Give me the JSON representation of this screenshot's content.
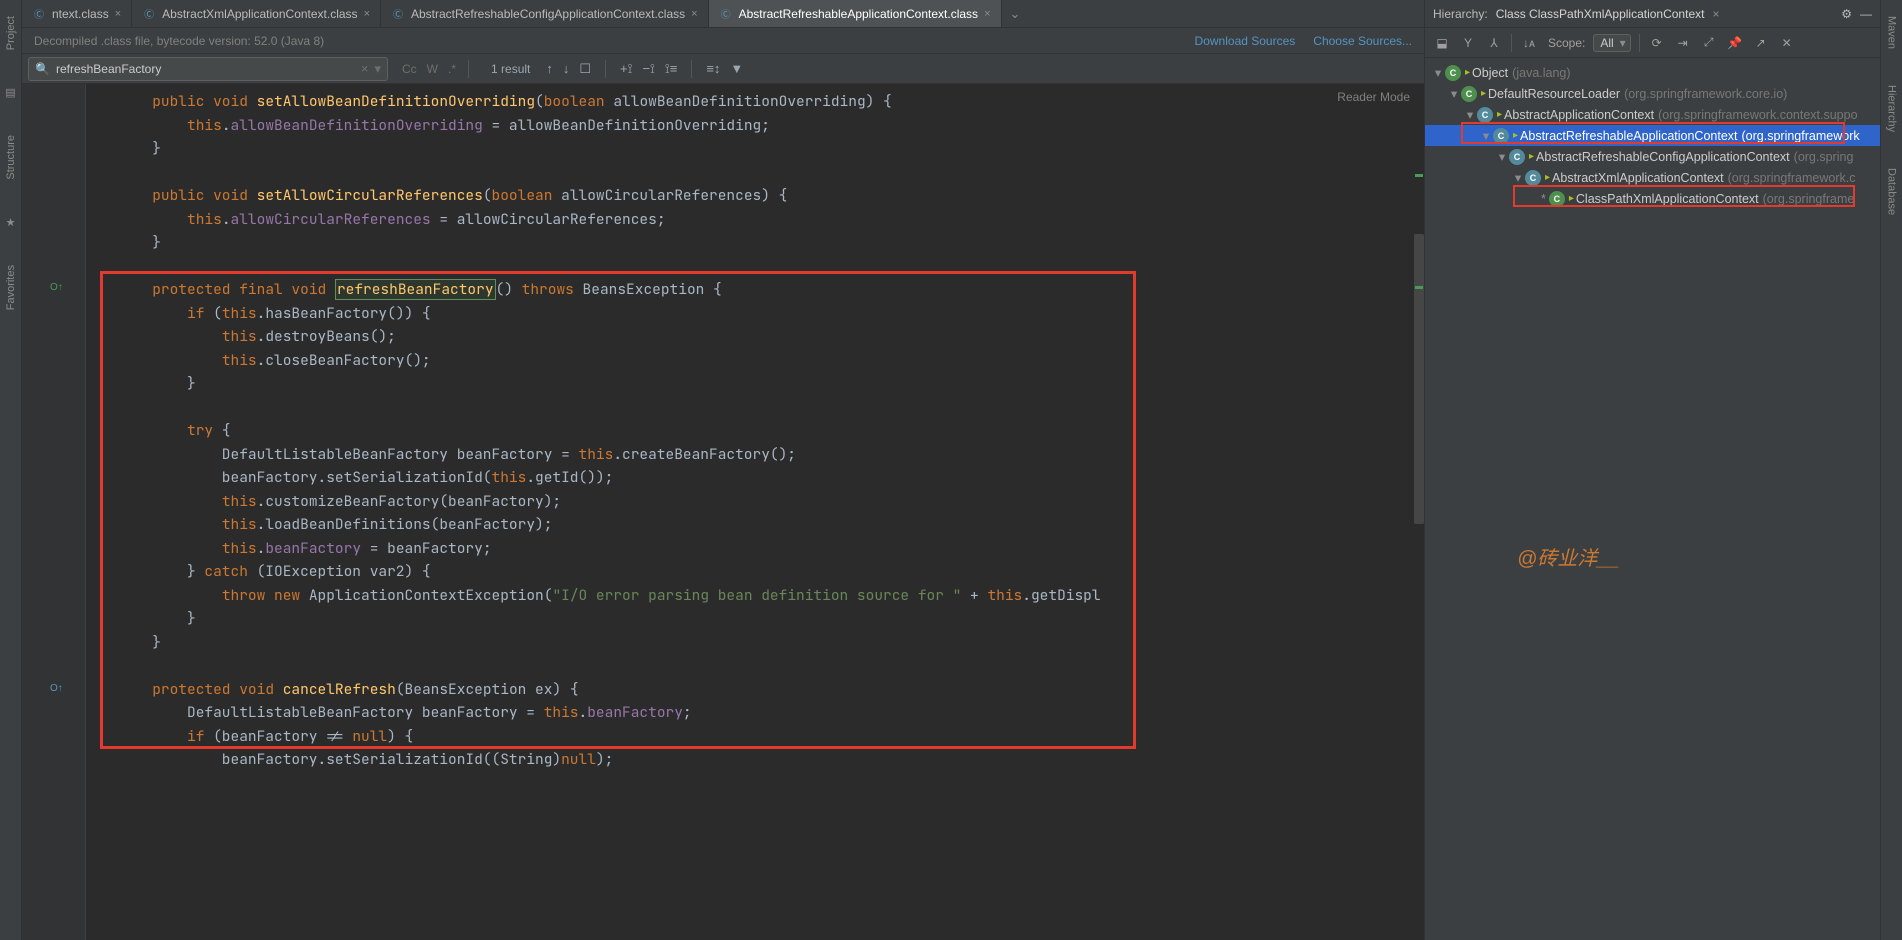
{
  "left_tools": {
    "project": "Project",
    "structure": "Structure",
    "favorites": "Favorites"
  },
  "right_tools": {
    "maven": "Maven",
    "hierarchy": "Hierarchy",
    "database": "Database"
  },
  "tabs": [
    {
      "label": "ntext.class"
    },
    {
      "label": "AbstractXmlApplicationContext.class"
    },
    {
      "label": "AbstractRefreshableConfigApplicationContext.class"
    },
    {
      "label": "AbstractRefreshableApplicationContext.class"
    }
  ],
  "active_tab_index": 3,
  "info_bar": {
    "text": "Decompiled .class file, bytecode version: 52.0 (Java 8)",
    "download": "Download Sources",
    "choose": "Choose Sources..."
  },
  "search": {
    "value": "refreshBeanFactory",
    "result": "1 result"
  },
  "reader_mode": "Reader Mode",
  "code_lines": [
    {
      "indent": 1,
      "tokens": [
        [
          "kw",
          "public"
        ],
        [
          "",
          " "
        ],
        [
          "kw",
          "void"
        ],
        [
          "",
          " "
        ],
        [
          "method",
          "setAllowBeanDefinitionOverriding"
        ],
        [
          "",
          "("
        ],
        [
          "kw",
          "boolean"
        ],
        [
          "",
          " allowBeanDefinitionOverriding) {"
        ]
      ]
    },
    {
      "indent": 2,
      "tokens": [
        [
          "this",
          "this"
        ],
        [
          "",
          "."
        ],
        [
          "field",
          "allowBeanDefinitionOverriding"
        ],
        [
          "",
          " = allowBeanDefinitionOverriding;"
        ]
      ]
    },
    {
      "indent": 1,
      "tokens": [
        [
          "",
          "}"
        ]
      ]
    },
    {
      "indent": 0,
      "tokens": [
        [
          "",
          ""
        ]
      ]
    },
    {
      "indent": 1,
      "tokens": [
        [
          "kw",
          "public"
        ],
        [
          "",
          " "
        ],
        [
          "kw",
          "void"
        ],
        [
          "",
          " "
        ],
        [
          "method",
          "setAllowCircularReferences"
        ],
        [
          "",
          "("
        ],
        [
          "kw",
          "boolean"
        ],
        [
          "",
          " allowCircularReferences) {"
        ]
      ]
    },
    {
      "indent": 2,
      "tokens": [
        [
          "this",
          "this"
        ],
        [
          "",
          "."
        ],
        [
          "field",
          "allowCircularReferences"
        ],
        [
          "",
          " = allowCircularReferences;"
        ]
      ]
    },
    {
      "indent": 1,
      "tokens": [
        [
          "",
          "}"
        ]
      ]
    },
    {
      "indent": 0,
      "tokens": [
        [
          "",
          ""
        ]
      ]
    },
    {
      "indent": 1,
      "tokens": [
        [
          "kw",
          "protected"
        ],
        [
          "",
          " "
        ],
        [
          "kw",
          "final"
        ],
        [
          "",
          " "
        ],
        [
          "kw",
          "void"
        ],
        [
          "",
          " "
        ],
        [
          "method highlight-box",
          "refreshBeanFactory"
        ],
        [
          "",
          "() "
        ],
        [
          "kw",
          "throws"
        ],
        [
          "",
          " BeansException {"
        ]
      ]
    },
    {
      "indent": 2,
      "tokens": [
        [
          "kw",
          "if"
        ],
        [
          "",
          " ("
        ],
        [
          "this",
          "this"
        ],
        [
          "",
          ".hasBeanFactory()) {"
        ]
      ]
    },
    {
      "indent": 3,
      "tokens": [
        [
          "this",
          "this"
        ],
        [
          "",
          ".destroyBeans();"
        ]
      ]
    },
    {
      "indent": 3,
      "tokens": [
        [
          "this",
          "this"
        ],
        [
          "",
          ".closeBeanFactory();"
        ]
      ]
    },
    {
      "indent": 2,
      "tokens": [
        [
          "",
          "}"
        ]
      ]
    },
    {
      "indent": 0,
      "tokens": [
        [
          "",
          ""
        ]
      ]
    },
    {
      "indent": 2,
      "tokens": [
        [
          "kw",
          "try"
        ],
        [
          "",
          " {"
        ]
      ]
    },
    {
      "indent": 3,
      "tokens": [
        [
          "",
          "DefaultListableBeanFactory beanFactory = "
        ],
        [
          "this",
          "this"
        ],
        [
          "",
          ".createBeanFactory();"
        ]
      ]
    },
    {
      "indent": 3,
      "tokens": [
        [
          "",
          "beanFactory.setSerializationId("
        ],
        [
          "this",
          "this"
        ],
        [
          "",
          ".getId());"
        ]
      ]
    },
    {
      "indent": 3,
      "tokens": [
        [
          "this",
          "this"
        ],
        [
          "",
          ".customizeBeanFactory(beanFactory);"
        ]
      ]
    },
    {
      "indent": 3,
      "tokens": [
        [
          "this",
          "this"
        ],
        [
          "",
          ".loadBeanDefinitions(beanFactory);"
        ]
      ]
    },
    {
      "indent": 3,
      "tokens": [
        [
          "this",
          "this"
        ],
        [
          "",
          "."
        ],
        [
          "field",
          "beanFactory"
        ],
        [
          "",
          " = beanFactory;"
        ]
      ]
    },
    {
      "indent": 2,
      "tokens": [
        [
          "",
          "} "
        ],
        [
          "kw",
          "catch"
        ],
        [
          "",
          " (IOException var2) {"
        ]
      ]
    },
    {
      "indent": 3,
      "tokens": [
        [
          "kw",
          "throw"
        ],
        [
          "",
          " "
        ],
        [
          "kw",
          "new"
        ],
        [
          "",
          " ApplicationContextException("
        ],
        [
          "str",
          "\"I/O error parsing bean definition source for \""
        ],
        [
          "",
          " + "
        ],
        [
          "this",
          "this"
        ],
        [
          "",
          ".getDispl"
        ]
      ]
    },
    {
      "indent": 2,
      "tokens": [
        [
          "",
          "}"
        ]
      ]
    },
    {
      "indent": 1,
      "tokens": [
        [
          "",
          "}"
        ]
      ]
    },
    {
      "indent": 0,
      "tokens": [
        [
          "",
          ""
        ]
      ]
    },
    {
      "indent": 1,
      "tokens": [
        [
          "kw",
          "protected"
        ],
        [
          "",
          " "
        ],
        [
          "kw",
          "void"
        ],
        [
          "",
          " "
        ],
        [
          "method",
          "cancelRefresh"
        ],
        [
          "",
          "(BeansException ex) {"
        ]
      ]
    },
    {
      "indent": 2,
      "tokens": [
        [
          "",
          "DefaultListableBeanFactory beanFactory = "
        ],
        [
          "this",
          "this"
        ],
        [
          "",
          "."
        ],
        [
          "field",
          "beanFactory"
        ],
        [
          "",
          ";"
        ]
      ]
    },
    {
      "indent": 2,
      "tokens": [
        [
          "kw",
          "if"
        ],
        [
          "",
          " (beanFactory != "
        ],
        [
          "kw",
          "null"
        ],
        [
          "",
          ") {"
        ]
      ]
    },
    {
      "indent": 3,
      "tokens": [
        [
          "",
          "beanFactory.setSerializationId((String)"
        ],
        [
          "kw",
          "null"
        ],
        [
          "",
          ");"
        ]
      ]
    }
  ],
  "hierarchy": {
    "title_label": "Hierarchy:",
    "title_value": "Class ClassPathXmlApplicationContext",
    "scope_label": "Scope:",
    "scope_value": "All",
    "nodes": [
      {
        "depth": 0,
        "kind": "class",
        "name": "Object",
        "pkg": "(java.lang)",
        "arrow": "▾"
      },
      {
        "depth": 1,
        "kind": "class",
        "name": "DefaultResourceLoader",
        "pkg": "(org.springframework.core.io)",
        "arrow": "▾"
      },
      {
        "depth": 2,
        "kind": "abs",
        "name": "AbstractApplicationContext",
        "pkg": "(org.springframework.context.suppo",
        "arrow": "▾"
      },
      {
        "depth": 3,
        "kind": "abs",
        "name": "AbstractRefreshableApplicationContext",
        "pkg": "(org.springframework",
        "arrow": "▾",
        "selected": true
      },
      {
        "depth": 4,
        "kind": "abs",
        "name": "AbstractRefreshableConfigApplicationContext",
        "pkg": "(org.spring",
        "arrow": "▾"
      },
      {
        "depth": 5,
        "kind": "abs",
        "name": "AbstractXmlApplicationContext",
        "pkg": "(org.springframework.c",
        "arrow": "▾"
      },
      {
        "depth": 6,
        "kind": "class",
        "name": "ClassPathXmlApplicationContext",
        "pkg": "(org.springframe",
        "arrow": "",
        "star": true
      }
    ]
  },
  "watermark": "@砖业洋__"
}
